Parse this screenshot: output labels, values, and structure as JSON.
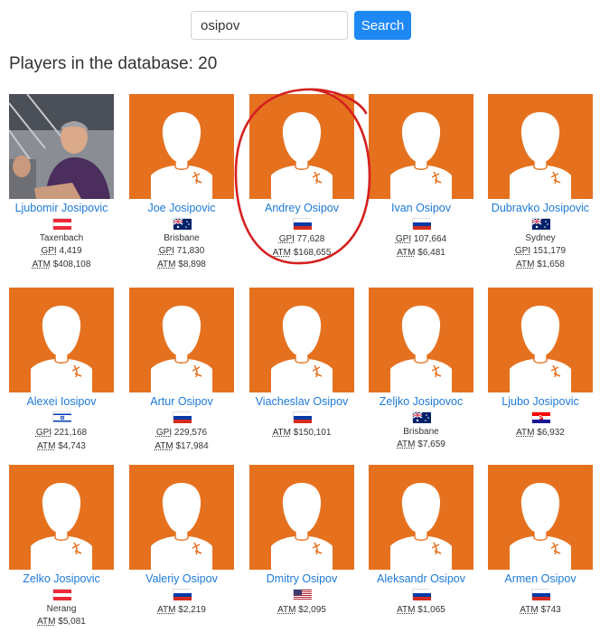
{
  "search": {
    "value": "osipov",
    "button_label": "Search"
  },
  "heading": "Players in the database: 20",
  "labels": {
    "gpi": "GPI",
    "atm": "ATM"
  },
  "players": [
    {
      "name": "Ljubomir Josipovic",
      "flag": "austria",
      "city": "Taxenbach",
      "gpi": "4,419",
      "atm": "$408,108",
      "photo": true
    },
    {
      "name": "Joe Josipovic",
      "flag": "australia",
      "city": "Brisbane",
      "gpi": "71,830",
      "atm": "$8,898"
    },
    {
      "name": "Andrey Osipov",
      "flag": "russia",
      "city": "",
      "gpi": "77,628",
      "atm": "$168,655"
    },
    {
      "name": "Ivan Osipov",
      "flag": "russia",
      "city": "",
      "gpi": "107,664",
      "atm": "$6,481"
    },
    {
      "name": "Dubravko Josipovic",
      "flag": "australia",
      "city": "Sydney",
      "gpi": "151,179",
      "atm": "$1,658"
    },
    {
      "name": "Alexei Iosipov",
      "flag": "israel",
      "city": "",
      "gpi": "221,168",
      "atm": "$4,743"
    },
    {
      "name": "Artur Osipov",
      "flag": "russia",
      "city": "",
      "gpi": "229,576",
      "atm": "$17,984"
    },
    {
      "name": "Viacheslav Osipov",
      "flag": "russia",
      "city": "",
      "gpi": "",
      "atm": "$150,101"
    },
    {
      "name": "Zeljko Josipovoc",
      "flag": "australia",
      "city": "Brisbane",
      "gpi": "",
      "atm": "$7,659"
    },
    {
      "name": "Ljubo Josipovic",
      "flag": "croatia",
      "city": "",
      "gpi": "",
      "atm": "$6,932"
    },
    {
      "name": "Zelko Josipovic",
      "flag": "austria",
      "city": "Nerang",
      "gpi": "",
      "atm": "$5,081"
    },
    {
      "name": "Valeriy Osipov",
      "flag": "russia",
      "city": "",
      "gpi": "",
      "atm": "$2,219"
    },
    {
      "name": "Dmitry Osipov",
      "flag": "usa",
      "city": "",
      "gpi": "",
      "atm": "$2,095"
    },
    {
      "name": "Aleksandr Osipov",
      "flag": "russia",
      "city": "",
      "gpi": "",
      "atm": "$1,065"
    },
    {
      "name": "Armen Osipov",
      "flag": "russia",
      "city": "",
      "gpi": "",
      "atm": "$743"
    }
  ],
  "colors": {
    "avatar_bg": "#e5711f",
    "link": "#1e7ad6",
    "button": "#1e88f5",
    "highlight": "#d42020"
  }
}
